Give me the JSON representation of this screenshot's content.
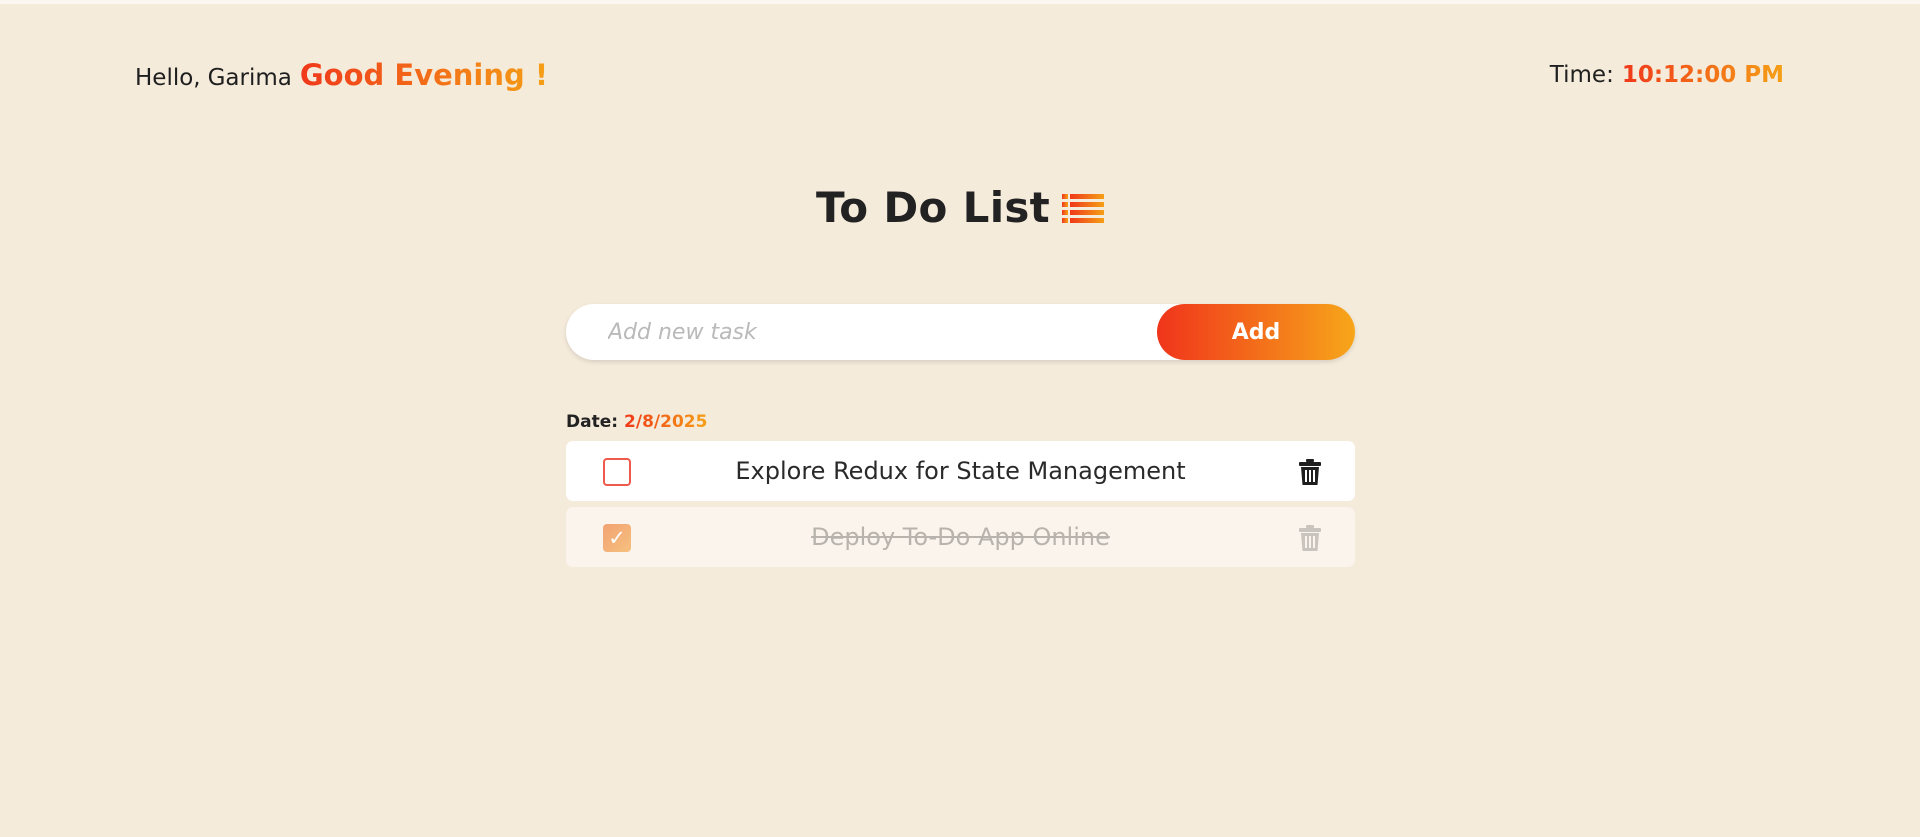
{
  "header": {
    "greeting_prefix": "Hello,",
    "user_name": "Garima",
    "period_greeting": "Good Evening !",
    "time_label": "Time:",
    "time_value": "10:12:00 PM"
  },
  "title": {
    "text": "To Do List",
    "icon": "list-icon"
  },
  "add_form": {
    "input_value": "",
    "placeholder": "Add new task",
    "button_label": "Add"
  },
  "date": {
    "label": "Date:",
    "value": "2/8/2025"
  },
  "tasks": [
    {
      "text": "Explore Redux for State Management",
      "completed": false,
      "delete_icon": "trash-icon"
    },
    {
      "text": "Deploy To-Do App Online",
      "completed": true,
      "delete_icon": "trash-icon"
    }
  ],
  "colors": {
    "background": "#f5ebdb",
    "accent_start": "#f0381a",
    "accent_end": "#f5a016",
    "checkbox_border": "#ee5a4c",
    "completed_text": "#b8b4ad"
  }
}
